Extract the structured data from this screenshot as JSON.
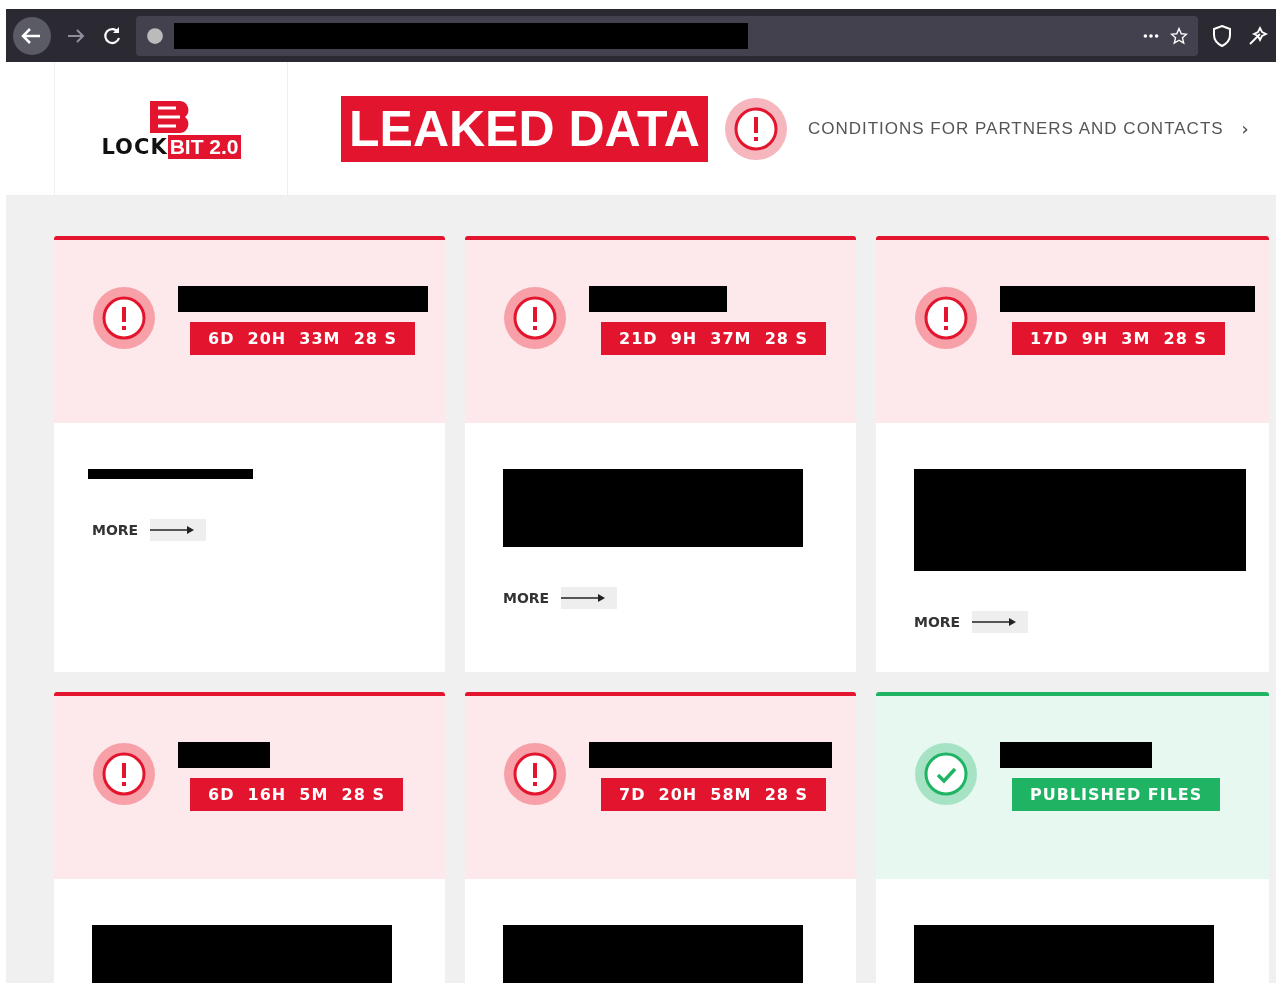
{
  "site": {
    "logo_word": "LOCK",
    "logo_badge": "BIT 2.0",
    "title": "LEAKED DATA",
    "nav_link": "CONDITIONS FOR PARTNERS AND CONTACTS",
    "nav_chevron": "›"
  },
  "cards": [
    {
      "kind": "countdown",
      "timer": "6D  20H  33M  28 S",
      "body": {
        "kind": "line"
      },
      "more": "MORE"
    },
    {
      "kind": "countdown",
      "timer": "21D  9H  37M  28 S",
      "body": {
        "kind": "block"
      },
      "more": "MORE"
    },
    {
      "kind": "countdown",
      "timer": "17D  9H  3M  28 S",
      "body": {
        "kind": "tall"
      },
      "more": "MORE"
    },
    {
      "kind": "countdown",
      "timer": "6D  16H  5M  28 S",
      "body": {
        "kind": "block"
      }
    },
    {
      "kind": "countdown",
      "timer": "7D  20H  58M  28 S",
      "body": {
        "kind": "block"
      }
    },
    {
      "kind": "published",
      "timer": "PUBLISHED FILES",
      "body": {
        "kind": "block"
      }
    }
  ]
}
